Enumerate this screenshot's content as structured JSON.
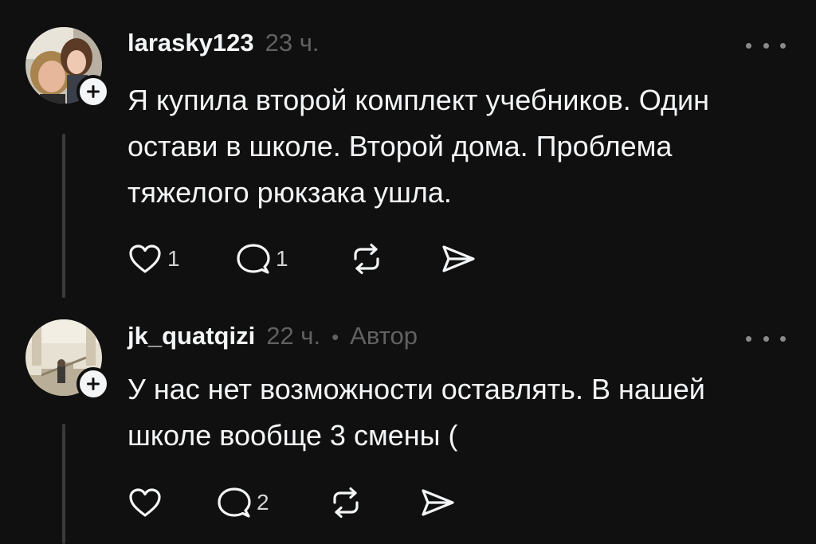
{
  "posts": [
    {
      "username": "larasky123",
      "time": "23 ч.",
      "author_tag": "",
      "text": "Я купила второй комплект учебников. Один\nостави в школе. Второй дома. Проблема\nтяжелого рюкзака ушла.",
      "likes": "1",
      "comments": "1",
      "avatar_icon": "profile-photo-mother-daughter",
      "icons": {
        "like": "heart-icon",
        "comment": "comment-bubble-icon",
        "repost": "repost-icon",
        "share": "send-icon",
        "more": "more-dots-icon",
        "follow": "plus-icon"
      }
    },
    {
      "username": "jk_quatqizi",
      "time": "22 ч.",
      "author_tag": "Автор",
      "separator": "•",
      "text": "У нас нет возможности оставлять. В нашей\nшколе вообще 3 смены (",
      "likes": "",
      "comments": "2",
      "avatar_icon": "profile-photo-staircase",
      "icons": {
        "like": "heart-icon",
        "comment": "comment-bubble-icon",
        "repost": "repost-icon",
        "share": "send-icon",
        "more": "more-dots-icon",
        "follow": "plus-icon"
      }
    }
  ],
  "colors": {
    "background": "#101010",
    "primary_text": "#f3f5f7",
    "secondary_text": "#616161",
    "thread_line": "#3a3a3a"
  }
}
